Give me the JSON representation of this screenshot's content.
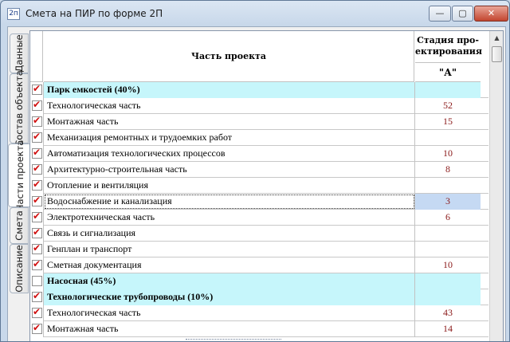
{
  "window": {
    "icon_text": "2п",
    "title": "Смета на ПИР по форме 2П",
    "controls": {
      "minimize": "—",
      "maximize": "▢",
      "close": "✕"
    }
  },
  "tabs": [
    {
      "label": "Данные",
      "active": false
    },
    {
      "label": "Состав объекта",
      "active": false
    },
    {
      "label": "Части проекта",
      "active": true
    },
    {
      "label": "Смета",
      "active": false
    },
    {
      "label": "Описание",
      "active": false
    }
  ],
  "grid": {
    "header": {
      "name": "Часть проекта",
      "stage_line1": "Стадия про-",
      "stage_line2": "ектирования",
      "stage_value": "\"А\""
    },
    "rows": [
      {
        "checked": true,
        "group": true,
        "name": "Парк емкостей (40%)",
        "value": ""
      },
      {
        "checked": true,
        "group": false,
        "name": "Технологическая часть",
        "value": "52"
      },
      {
        "checked": true,
        "group": false,
        "name": "Монтажная часть",
        "value": "15"
      },
      {
        "checked": true,
        "group": false,
        "name": "Механизация ремонтных и трудоемких работ",
        "value": ""
      },
      {
        "checked": true,
        "group": false,
        "name": "Автоматизация технологических процессов",
        "value": "10"
      },
      {
        "checked": true,
        "group": false,
        "name": "Архитектурно-строительная часть",
        "value": "8"
      },
      {
        "checked": true,
        "group": false,
        "name": "Отопление и вентиляция",
        "value": ""
      },
      {
        "checked": true,
        "group": false,
        "name": "Водоснабжение и канализация",
        "value": "3",
        "selected": true
      },
      {
        "checked": true,
        "group": false,
        "name": "Электротехническая часть",
        "value": "6"
      },
      {
        "checked": true,
        "group": false,
        "name": "Связь и сигнализация",
        "value": ""
      },
      {
        "checked": true,
        "group": false,
        "name": "Генплан и транспорт",
        "value": ""
      },
      {
        "checked": true,
        "group": false,
        "name": "Сметная документация",
        "value": "10"
      },
      {
        "checked": false,
        "group": true,
        "name": "Насосная (45%)",
        "value": ""
      },
      {
        "checked": true,
        "group": true,
        "name": "Технологические трубопроводы (10%)",
        "value": ""
      },
      {
        "checked": true,
        "group": false,
        "name": "Технологическая часть",
        "value": "43"
      },
      {
        "checked": true,
        "group": false,
        "name": "Монтажная часть",
        "value": "14"
      }
    ]
  },
  "scrollbar": {
    "up": "▲"
  },
  "colors": {
    "group_row": "#c6f6fb",
    "value_text": "#8b1a1a",
    "check": "#d01010",
    "selected_cell": "#c5d9f3"
  }
}
